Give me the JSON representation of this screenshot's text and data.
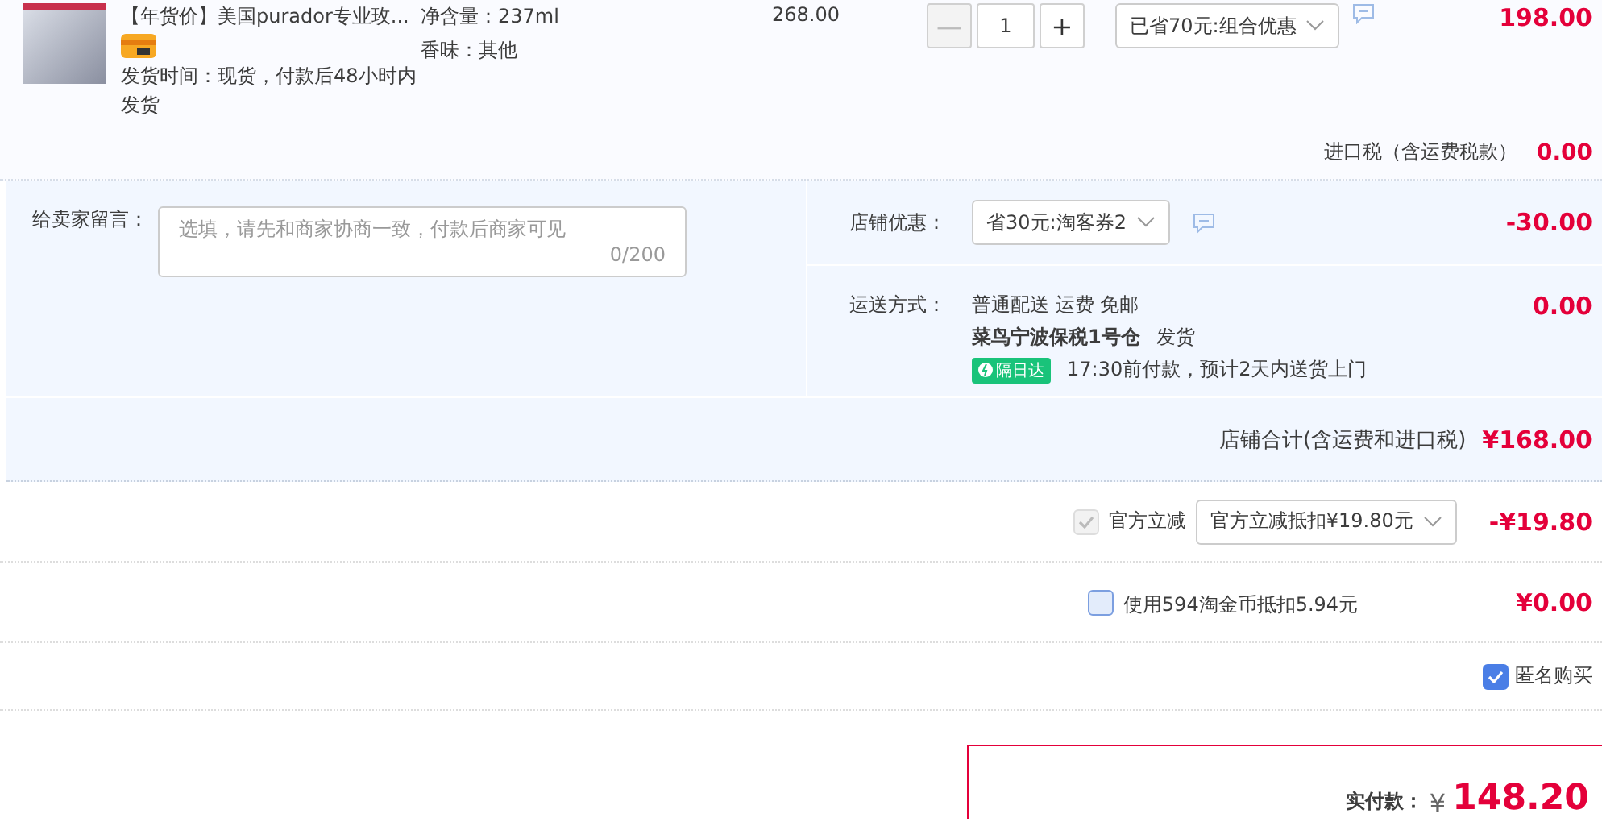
{
  "product": {
    "title": "【年货价】美国purador专业玫...",
    "delivery": "发货时间：现货，付款后48小时内发货",
    "specs": [
      "净含量：237ml",
      "香味：其他"
    ],
    "unit_price": "268.00",
    "quantity": "1",
    "decrease": "—",
    "increase": "+",
    "promo": "已省70元:组合优惠",
    "total": "198.00"
  },
  "import_tax": {
    "label": "进口税（含运费税款）",
    "value": "0.00"
  },
  "note": {
    "label": "给卖家留言：",
    "placeholder": "选填，请先和商家协商一致，付款后商家可见",
    "counter": "0/200"
  },
  "shop_discount": {
    "label": "店铺优惠：",
    "option": "省30元:淘客券2",
    "value": "-30.00"
  },
  "shipping": {
    "label": "运送方式：",
    "method": "普通配送 运费 免邮",
    "warehouse": "菜鸟宁波保税1号仓",
    "ship_word": "发货",
    "badge": "隔日达",
    "eta": "17:30前付款，预计2天内送货上门",
    "value": "0.00"
  },
  "shop_total": {
    "label": "店铺合计(含运费和进口税)",
    "value": "¥168.00"
  },
  "official": {
    "checked": true,
    "disabled": true,
    "label": "官方立减",
    "option": "官方立减抵扣¥19.80元",
    "value": "-¥19.80"
  },
  "coins": {
    "checked": false,
    "label": "使用594淘金币抵扣5.94元",
    "value": "¥0.00"
  },
  "anonymous": {
    "checked": true,
    "label": "匿名购买"
  },
  "pay": {
    "label": "实付款：",
    "currency": "¥",
    "value": "148.20"
  }
}
